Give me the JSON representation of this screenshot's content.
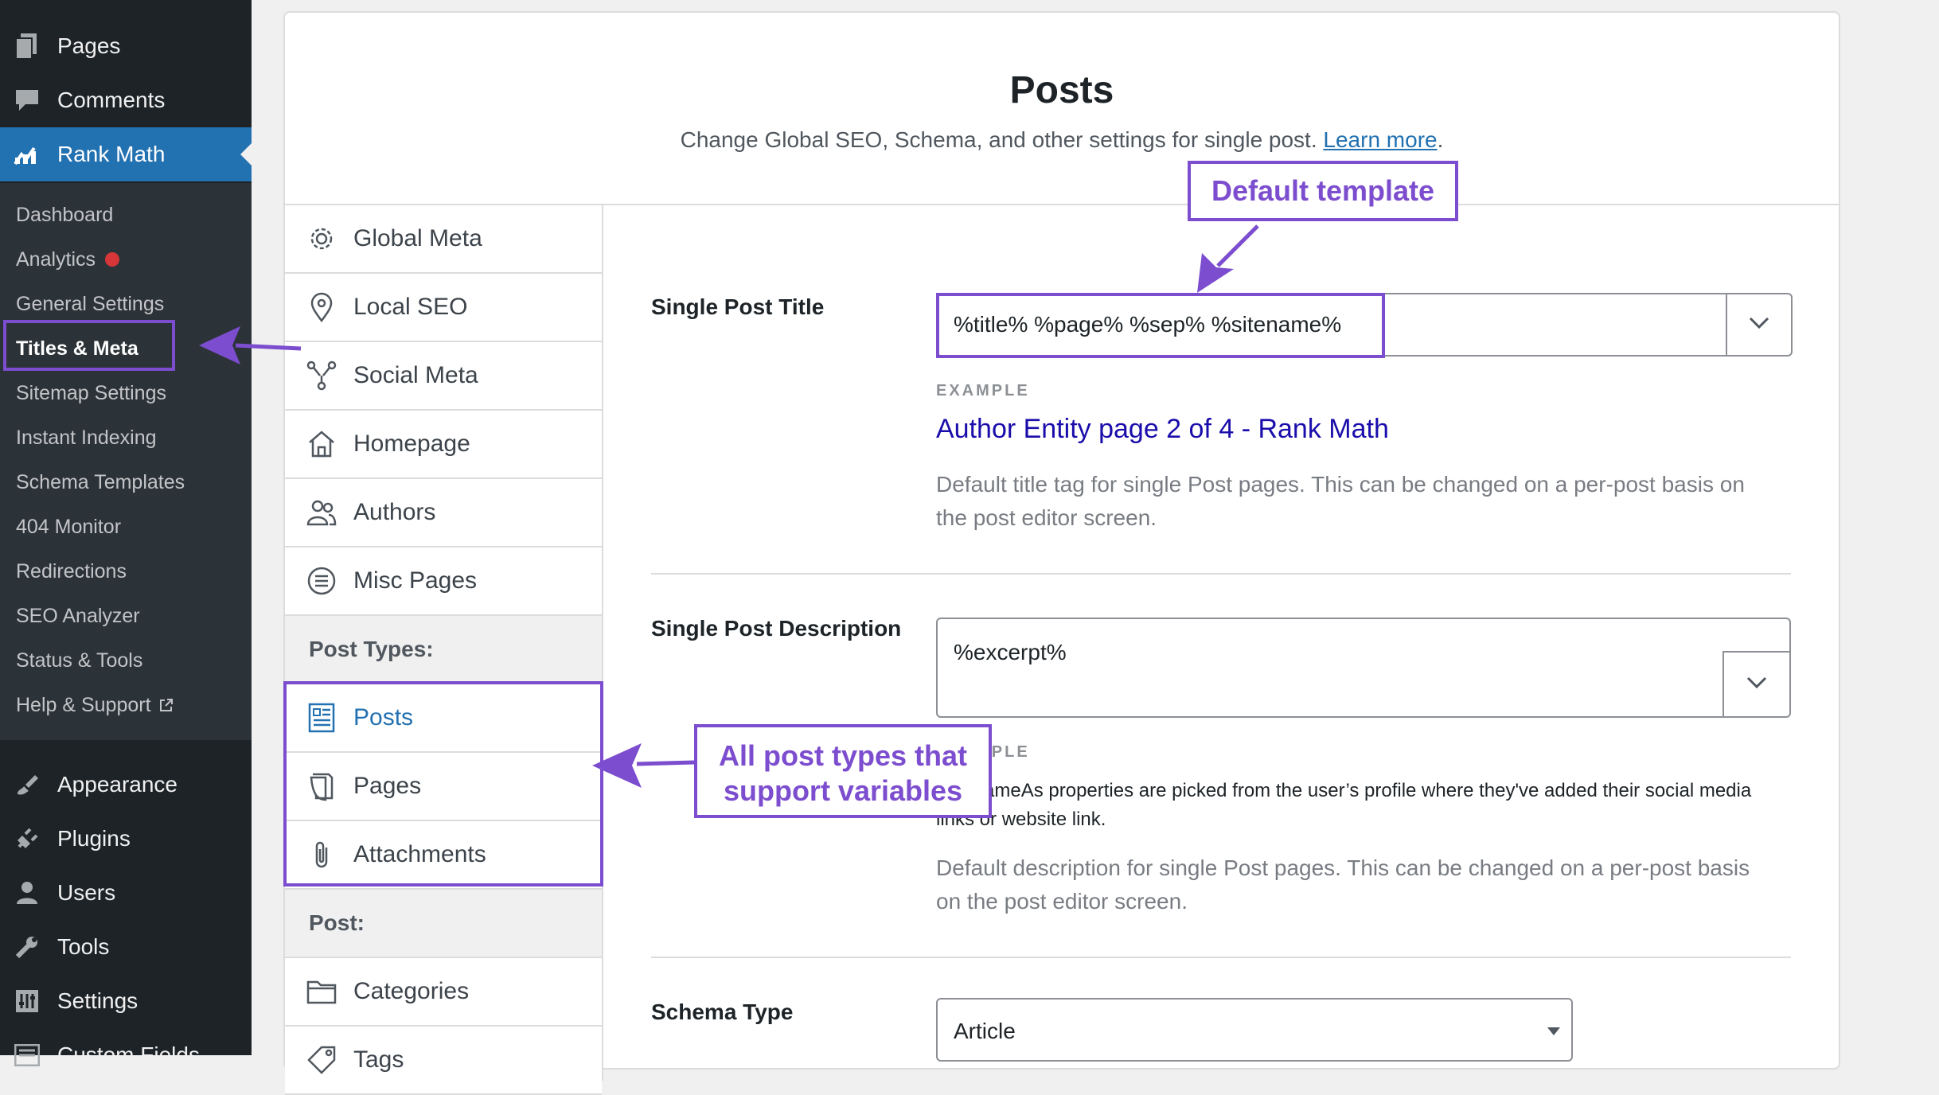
{
  "sidebar": {
    "top_items": [
      {
        "label": "Pages",
        "icon": "pages-icon"
      },
      {
        "label": "Comments",
        "icon": "comments-icon"
      },
      {
        "label": "Rank Math",
        "icon": "rank-math-icon"
      }
    ],
    "submenu": [
      {
        "label": "Dashboard"
      },
      {
        "label": "Analytics"
      },
      {
        "label": "General Settings"
      },
      {
        "label": "Titles & Meta"
      },
      {
        "label": "Sitemap Settings"
      },
      {
        "label": "Instant Indexing"
      },
      {
        "label": "Schema Templates"
      },
      {
        "label": "404 Monitor"
      },
      {
        "label": "Redirections"
      },
      {
        "label": "SEO Analyzer"
      },
      {
        "label": "Status & Tools"
      },
      {
        "label": "Help & Support"
      }
    ],
    "bottom_items": [
      {
        "label": "Appearance",
        "icon": "appearance-icon"
      },
      {
        "label": "Plugins",
        "icon": "plugins-icon"
      },
      {
        "label": "Users",
        "icon": "users-icon"
      },
      {
        "label": "Tools",
        "icon": "tools-icon"
      },
      {
        "label": "Settings",
        "icon": "settings-icon"
      },
      {
        "label": "Custom Fields",
        "icon": "custom-fields-icon"
      }
    ]
  },
  "header": {
    "title": "Posts",
    "subtitle": "Change Global SEO, Schema, and other settings for single post.",
    "learn_more": "Learn more",
    "period": "."
  },
  "settings_nav": {
    "items": [
      {
        "label": "Global Meta",
        "icon": "gear-icon"
      },
      {
        "label": "Local SEO",
        "icon": "location-pin-icon"
      },
      {
        "label": "Social Meta",
        "icon": "social-share-icon"
      },
      {
        "label": "Homepage",
        "icon": "home-icon"
      },
      {
        "label": "Authors",
        "icon": "authors-icon"
      },
      {
        "label": "Misc Pages",
        "icon": "list-icon"
      }
    ],
    "post_types_heading": "Post Types:",
    "post_types": [
      {
        "label": "Posts",
        "icon": "post-icon"
      },
      {
        "label": "Pages",
        "icon": "page-icon"
      },
      {
        "label": "Attachments",
        "icon": "paperclip-icon"
      }
    ],
    "post_heading": "Post:",
    "post_items": [
      {
        "label": "Categories",
        "icon": "folder-icon"
      },
      {
        "label": "Tags",
        "icon": "tag-icon"
      }
    ]
  },
  "form": {
    "single_post_title": {
      "label": "Single Post Title",
      "value": "%title% %page% %sep% %sitename%",
      "example_label": "EXAMPLE",
      "example_value": "Author Entity page 2 of 4 - Rank Math",
      "help": "Default title tag for single Post pages. This can be changed on a per-post basis on the post editor screen."
    },
    "single_post_description": {
      "label": "Single Post Description",
      "value": "%excerpt%",
      "example_label": "EXAMPLE",
      "example_value": "The sameAs properties are picked from the user’s profile where they've added their social media links or website link.",
      "help": "Default description for single Post pages. This can be changed on a per-post basis on the post editor screen."
    },
    "schema_type": {
      "label": "Schema Type",
      "value": "Article"
    }
  },
  "annotations": {
    "default_template": "Default template",
    "post_types_line1": "All post types that",
    "post_types_line2": "support variables",
    "color": "#7c4dce"
  },
  "colors": {
    "admin_bar": "#1d2327",
    "submenu_bg": "#2c3338",
    "accent": "#2271b1",
    "example_link": "#1a0dab",
    "annotation": "#7c4dce"
  }
}
